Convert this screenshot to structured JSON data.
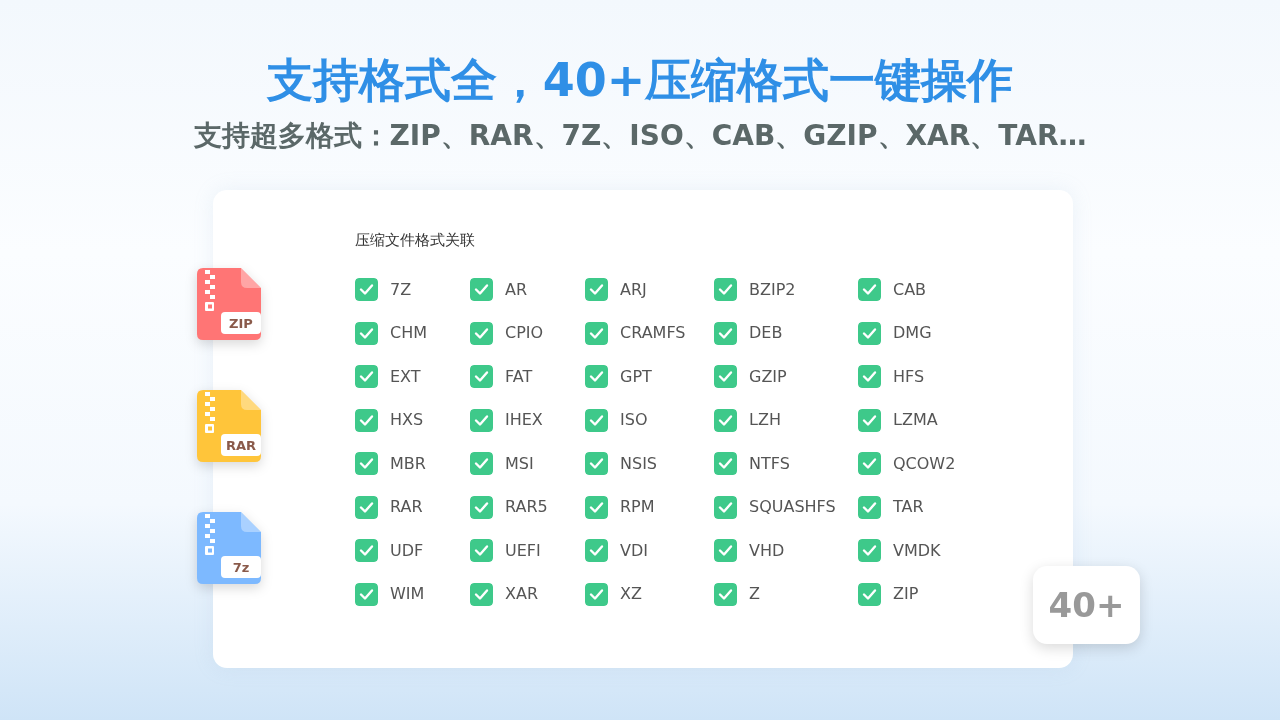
{
  "headline": "支持格式全，40+压缩格式一键操作",
  "subtitle": "支持超多格式：ZIP、RAR、7Z、ISO、CAB、GZIP、XAR、TAR…",
  "file_icons": [
    {
      "label": "ZIP",
      "color": "#ff7575"
    },
    {
      "label": "RAR",
      "color": "#ffc53a"
    },
    {
      "label": "7z",
      "color": "#7db9ff"
    }
  ],
  "panel": {
    "title": "压缩文件格式关联",
    "formats": [
      {
        "label": "7Z",
        "checked": true
      },
      {
        "label": "AR",
        "checked": true
      },
      {
        "label": "ARJ",
        "checked": true
      },
      {
        "label": "BZIP2",
        "checked": true
      },
      {
        "label": "CAB",
        "checked": true
      },
      {
        "label": "CHM",
        "checked": true
      },
      {
        "label": "CPIO",
        "checked": true
      },
      {
        "label": "CRAMFS",
        "checked": true
      },
      {
        "label": "DEB",
        "checked": true
      },
      {
        "label": "DMG",
        "checked": true
      },
      {
        "label": "EXT",
        "checked": true
      },
      {
        "label": "FAT",
        "checked": true
      },
      {
        "label": "GPT",
        "checked": true
      },
      {
        "label": "GZIP",
        "checked": true
      },
      {
        "label": "HFS",
        "checked": true
      },
      {
        "label": "HXS",
        "checked": true
      },
      {
        "label": "IHEX",
        "checked": true
      },
      {
        "label": "ISO",
        "checked": true
      },
      {
        "label": "LZH",
        "checked": true
      },
      {
        "label": "LZMA",
        "checked": true
      },
      {
        "label": "MBR",
        "checked": true
      },
      {
        "label": "MSI",
        "checked": true
      },
      {
        "label": "NSIS",
        "checked": true
      },
      {
        "label": "NTFS",
        "checked": true
      },
      {
        "label": "QCOW2",
        "checked": true
      },
      {
        "label": "RAR",
        "checked": true
      },
      {
        "label": "RAR5",
        "checked": true
      },
      {
        "label": "RPM",
        "checked": true
      },
      {
        "label": "SQUASHFS",
        "checked": true
      },
      {
        "label": "TAR",
        "checked": true
      },
      {
        "label": "UDF",
        "checked": true
      },
      {
        "label": "UEFI",
        "checked": true
      },
      {
        "label": "VDI",
        "checked": true
      },
      {
        "label": "VHD",
        "checked": true
      },
      {
        "label": "VMDK",
        "checked": true
      },
      {
        "label": "WIM",
        "checked": true
      },
      {
        "label": "XAR",
        "checked": true
      },
      {
        "label": "XZ",
        "checked": true
      },
      {
        "label": "Z",
        "checked": true
      },
      {
        "label": "ZIP",
        "checked": true
      }
    ],
    "count_badge": "40+"
  }
}
